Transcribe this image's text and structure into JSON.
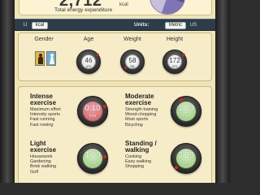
{
  "summary": {
    "total_value": "2,712",
    "total_unit": "kcal",
    "total_label": "Total energy expenditure"
  },
  "units_bar": {
    "energy_options": [
      "IJ",
      "kcal"
    ],
    "energy_selected": "kcal",
    "units_label": "Units:",
    "system_options": [
      "Metric",
      "US"
    ],
    "system_selected": "Metric"
  },
  "profile": {
    "gender_label": "Gender",
    "gender_selected": "female",
    "age": {
      "label": "Age",
      "value": "46",
      "unit": "yrs"
    },
    "weight": {
      "label": "Weight",
      "value": "58",
      "unit": "kg"
    },
    "height": {
      "label": "Height",
      "value": "172",
      "unit": "cm"
    }
  },
  "activities": [
    {
      "title_line1": "Intense",
      "title_line2": "exercise",
      "examples": [
        "Maximum effort",
        "Intensity sports",
        "Fast running",
        "Fast rowing"
      ],
      "time": "0:10",
      "unit": "h:m",
      "face": "red"
    },
    {
      "title_line1": "Moderate",
      "title_line2": "exercise",
      "examples": [
        "Strength training",
        "Wood-chopping",
        "Most sports",
        "Bicycling"
      ],
      "time": "1:20",
      "unit": "h:m",
      "face": "green"
    },
    {
      "title_line1": "Light",
      "title_line2": "exercise",
      "examples": [
        "Housework",
        "Gardening",
        "Brisk walking",
        "Golf"
      ],
      "time": "1:00",
      "unit": "h:m",
      "face": "green"
    },
    {
      "title_line1": "Standing /",
      "title_line2": "walking",
      "examples": [
        "Cooking",
        "Easy walking",
        "Shopping"
      ],
      "time": "2:30",
      "unit": "h:m",
      "face": "green"
    }
  ]
}
